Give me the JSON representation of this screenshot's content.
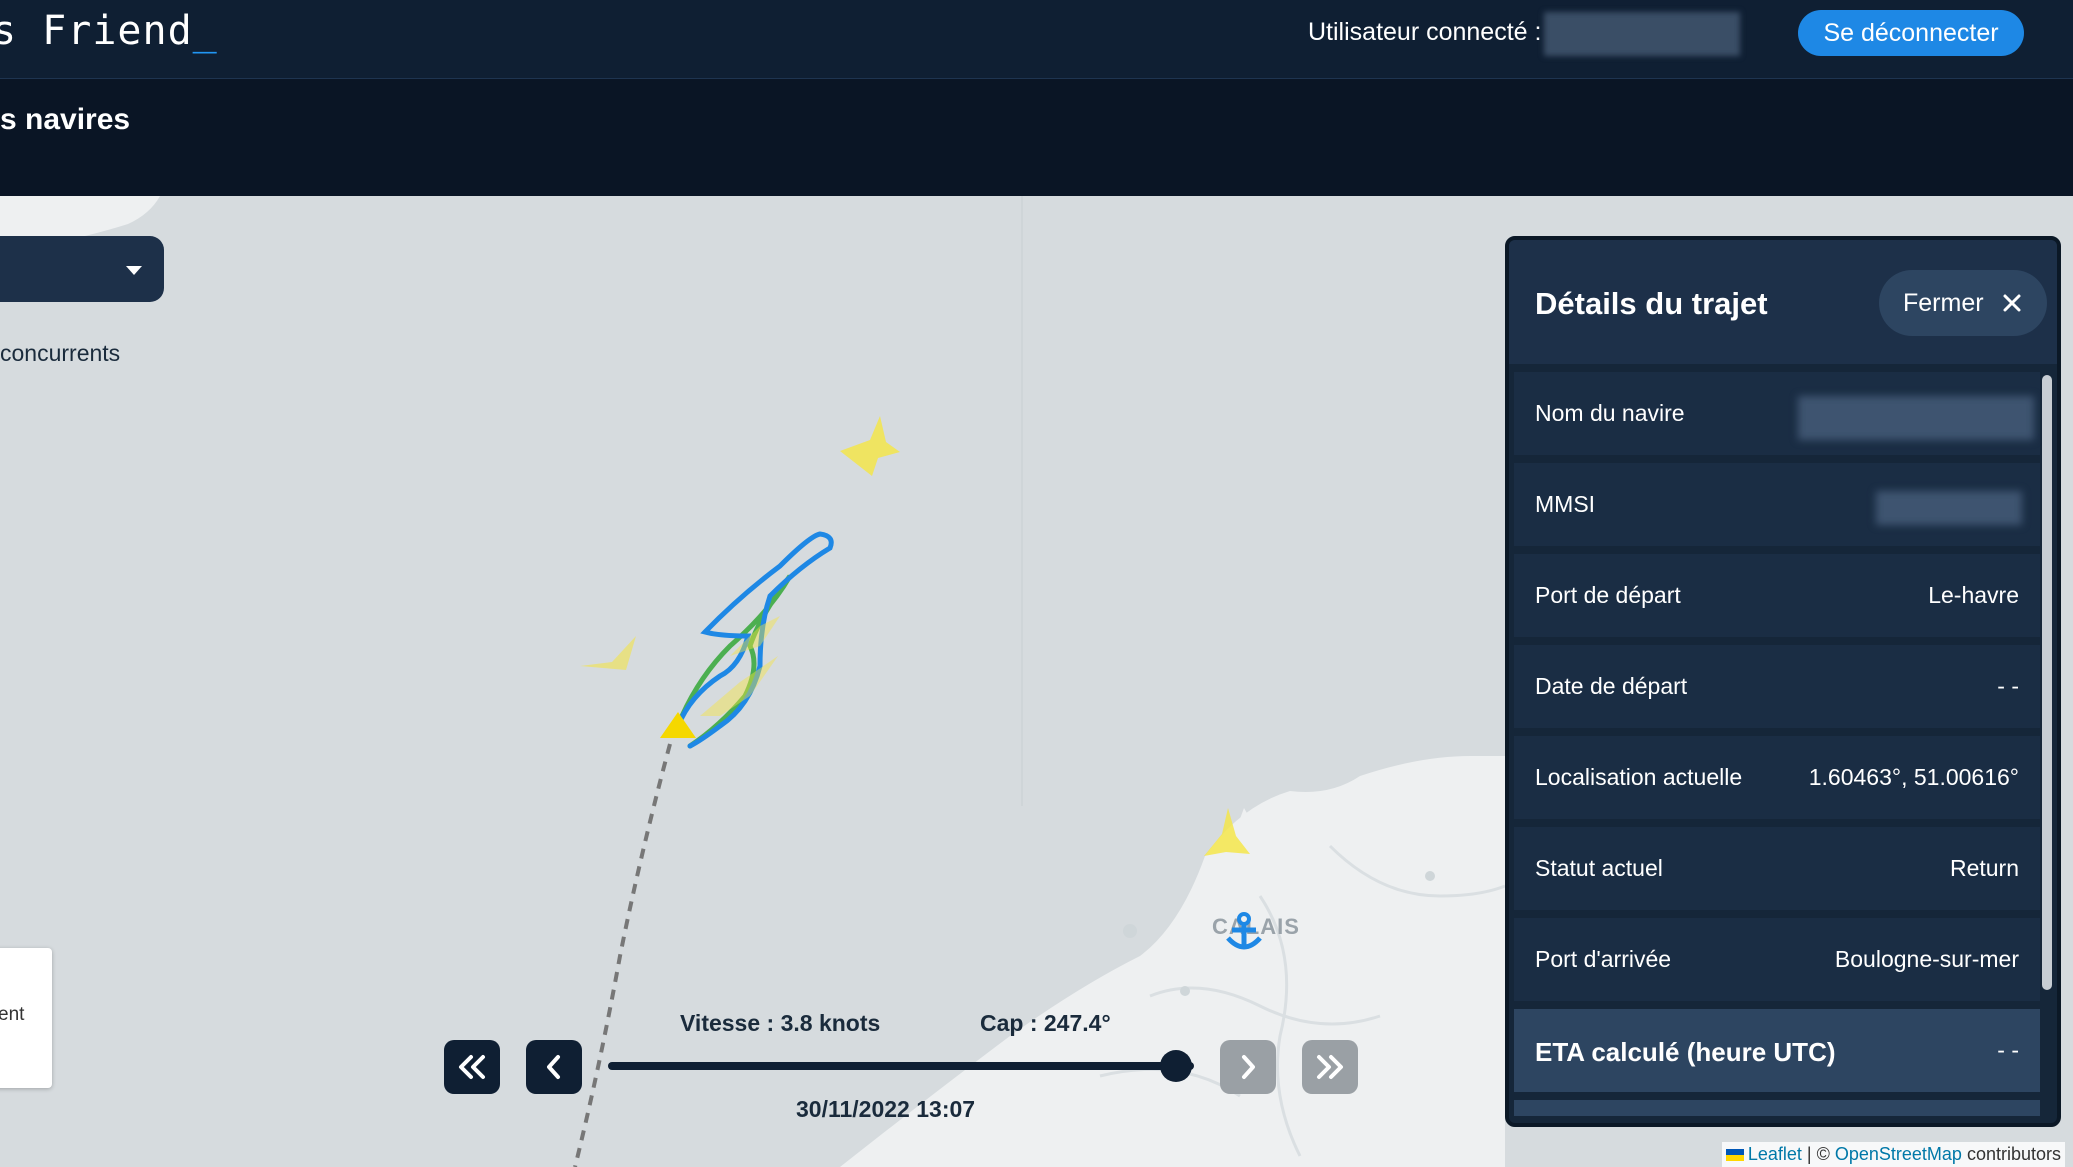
{
  "header": {
    "brand": "s Friend",
    "brand_cursor": "_",
    "user_label": "Utilisateur connecté :",
    "logout_label": "Se déconnecter"
  },
  "subheader": {
    "title": "s navires"
  },
  "map": {
    "competitors_label": "concurrents",
    "legend_partial_text": "ent",
    "city_label": "CALAIS",
    "attribution": {
      "leaflet": "Leaflet",
      "separator": "| ©",
      "osm": "OpenStreetMap",
      "suffix": "contributors"
    }
  },
  "playback": {
    "speed": "Vitesse : 3.8 knots",
    "heading": "Cap : 247.4°",
    "datetime": "30/11/2022 13:07",
    "progress": 0.97,
    "buttons": {
      "rewind_icon": "double-chevron-left-icon",
      "back_icon": "chevron-left-icon",
      "forward_icon": "chevron-right-icon",
      "fastforward_icon": "double-chevron-right-icon"
    }
  },
  "panel": {
    "title": "Détails du trajet",
    "close_label": "Fermer",
    "rows": [
      {
        "label": "Nom du navire",
        "value": ""
      },
      {
        "label": "MMSI",
        "value": ""
      },
      {
        "label": "Port de départ",
        "value": "Le-havre"
      },
      {
        "label": "Date de départ",
        "value": "- -"
      },
      {
        "label": "Localisation actuelle",
        "value": "1.60463°, 51.00616°"
      },
      {
        "label": "Statut actuel",
        "value": "Return"
      },
      {
        "label": "Port d'arrivée",
        "value": "Boulogne-sur-mer"
      },
      {
        "label": "ETA calculé (heure UTC)",
        "value": "- -"
      }
    ]
  },
  "colors": {
    "header_bg": "#0f1f33",
    "accent": "#1e88e5",
    "track_blue": "#2196f3",
    "track_green": "#4caf50",
    "ship_yellow": "#f5e642"
  }
}
